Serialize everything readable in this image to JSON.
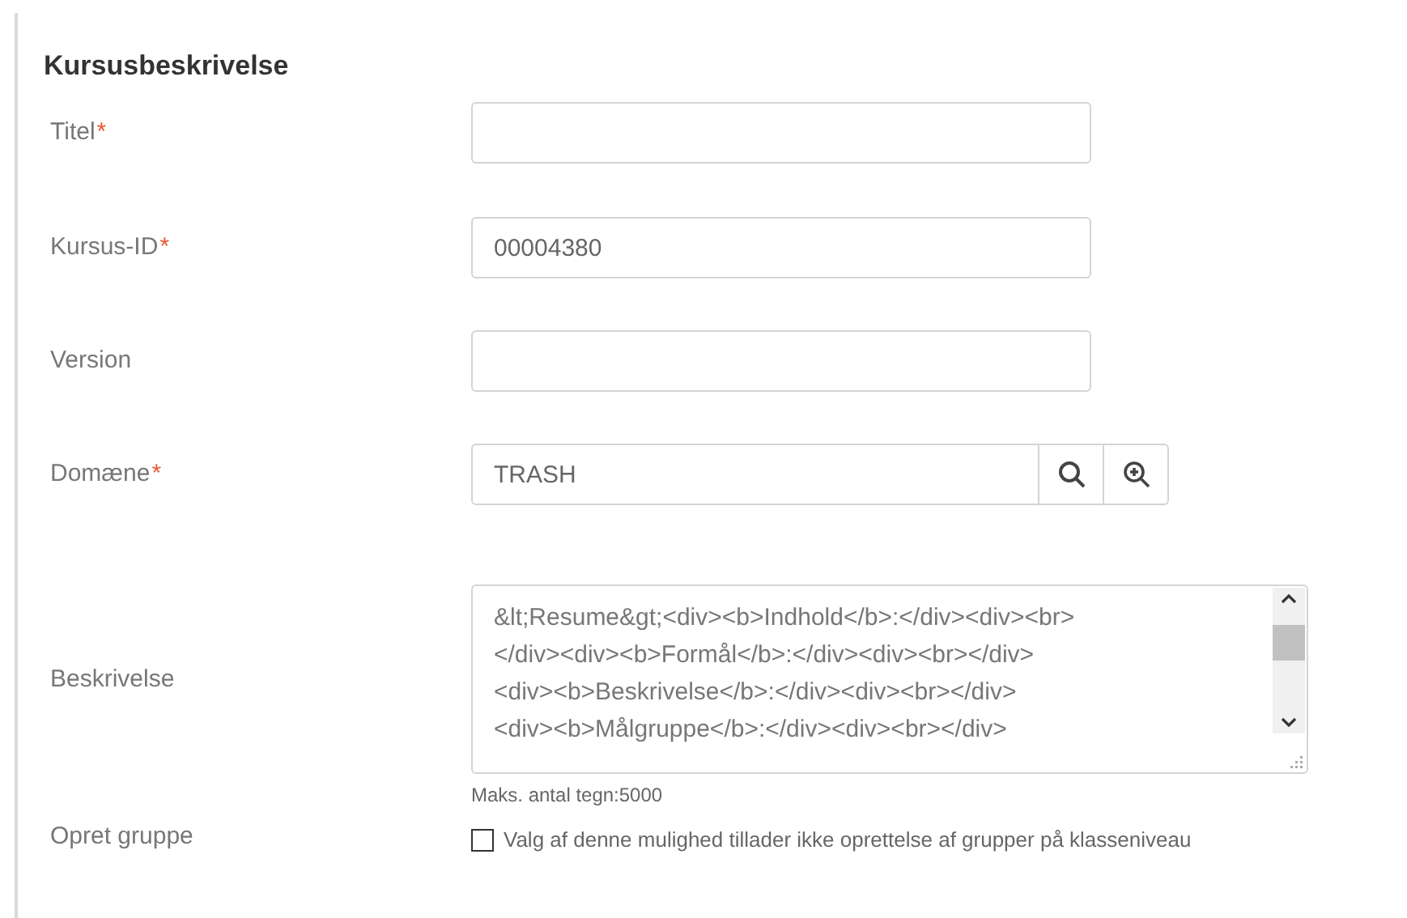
{
  "section": {
    "title": "Kursusbeskrivelse"
  },
  "fields": [
    {
      "kind": "text",
      "label": "Titel",
      "required_mark": "*"
    },
    {
      "kind": "text",
      "label": "Kursus-ID",
      "required_mark": "*",
      "value": "00004380"
    },
    {
      "kind": "text",
      "label": "Version"
    },
    {
      "kind": "lookup",
      "label": "Domæne",
      "required_mark": "*",
      "value": "TRASH"
    },
    {
      "kind": "textarea",
      "label": "Beskrivelse",
      "lines": [
        "&lt;Resume&gt;<div><b>Indhold</b>:</div><div><br>",
        "</div><div><b>Formål</b>:</div><div><br></div>",
        "<div><b>Beskrivelse</b>:</div><div><br></div>",
        "<div><b>Målgruppe</b>:</div><div><br></div>"
      ],
      "hint": "Maks. antal tegn:5000"
    },
    {
      "kind": "checkbox",
      "label": "Opret gruppe",
      "checked": false,
      "text": "Valg af denne mulighed tillader ikke oprettelse af grupper på klasseniveau"
    }
  ]
}
